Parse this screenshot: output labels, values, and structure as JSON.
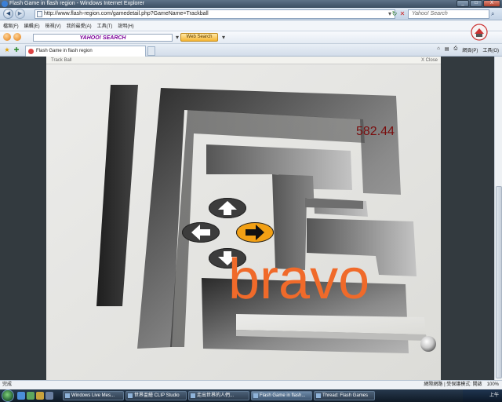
{
  "window": {
    "title": "Flash Game in flash region - Windows Internet Explorer",
    "controls": [
      "_",
      "□",
      "X"
    ]
  },
  "address_bar": {
    "url": "http://www.flash-region.com/gamedetail.php?GameName=Trackball",
    "search_placeholder": "Yahoo! Search"
  },
  "menu": {
    "items": [
      "檔案(F)",
      "編輯(E)",
      "檢視(V)",
      "我的最愛(A)",
      "工具(T)",
      "說明(H)"
    ]
  },
  "yahoo_toolbar": {
    "search_label": "YAHOO! SEARCH",
    "web_search_button": "Web Search"
  },
  "tabs": [
    {
      "label": "Flash Game in flash region"
    }
  ],
  "command_bar": {
    "items": [
      "網頁(P)",
      "工具(O)"
    ]
  },
  "game": {
    "header_title": "Track Ball",
    "close_label": "X Close",
    "timer": "582.44",
    "message": "bravo",
    "controls": {
      "up": {
        "active": false
      },
      "left": {
        "active": false
      },
      "right": {
        "active": true
      },
      "down": {
        "active": false
      }
    }
  },
  "status_bar": {
    "left": "完成",
    "zone": "網際網路 | 受保護模式: 開啟",
    "zoom": "100%"
  },
  "taskbar": {
    "tasks": [
      {
        "label": "Windows Live Mes..."
      },
      {
        "label": "世界盃繪 CLIP Studio"
      },
      {
        "label": "走出世界的人們..."
      },
      {
        "label": "Flash Game in flash..."
      },
      {
        "label": "Thread: Flash Games"
      }
    ],
    "active_task": "Flash Game in flash...",
    "clock": "上午"
  },
  "colors": {
    "timer": "#7a0d0d",
    "bravo": "#f06a2a",
    "active_control": "#f2a014",
    "control": "#3c3c3c"
  }
}
